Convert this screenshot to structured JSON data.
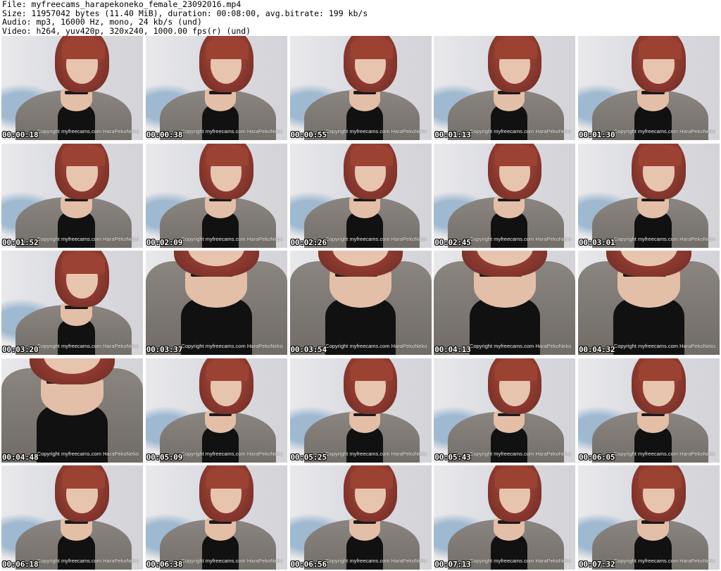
{
  "header": {
    "file_line": "File: myfreecams_harapekoneko_female_23092016.mp4",
    "size_line": "Size: 11957042 bytes (11.40 MiB), duration: 00:08:00, avg.bitrate: 199 kb/s",
    "audio_line": "Audio: mp3, 16000 Hz, mono, 24 kb/s (und)",
    "video_line": "Video: h264, yuv420p, 320x240, 1000.00 fps(r) (und)"
  },
  "watermark_text": "Copyright myfreecams.com HaraPekoNeko",
  "thumbnails": [
    {
      "time": "00:00:18",
      "shot": "wide"
    },
    {
      "time": "00:00:38",
      "shot": "wide"
    },
    {
      "time": "00:00:55",
      "shot": "wide"
    },
    {
      "time": "00:01:13",
      "shot": "wide"
    },
    {
      "time": "00:01:30",
      "shot": "wide"
    },
    {
      "time": "00:01:52",
      "shot": "wide"
    },
    {
      "time": "00:02:09",
      "shot": "wide"
    },
    {
      "time": "00:02:26",
      "shot": "wide"
    },
    {
      "time": "00:02:45",
      "shot": "wide"
    },
    {
      "time": "00:03:01",
      "shot": "wide"
    },
    {
      "time": "00:03:20",
      "shot": "wide"
    },
    {
      "time": "00:03:37",
      "shot": "close"
    },
    {
      "time": "00:03:54",
      "shot": "close"
    },
    {
      "time": "00:04:13",
      "shot": "close"
    },
    {
      "time": "00:04:32",
      "shot": "close"
    },
    {
      "time": "00:04:48",
      "shot": "close"
    },
    {
      "time": "00:05:09",
      "shot": "wide"
    },
    {
      "time": "00:05:25",
      "shot": "wide"
    },
    {
      "time": "00:05:43",
      "shot": "wide"
    },
    {
      "time": "00:06:05",
      "shot": "wide"
    },
    {
      "time": "00:06:18",
      "shot": "wide"
    },
    {
      "time": "00:06:38",
      "shot": "wide"
    },
    {
      "time": "00:06:56",
      "shot": "wide"
    },
    {
      "time": "00:07:13",
      "shot": "wide"
    },
    {
      "time": "00:07:32",
      "shot": "wide"
    }
  ]
}
